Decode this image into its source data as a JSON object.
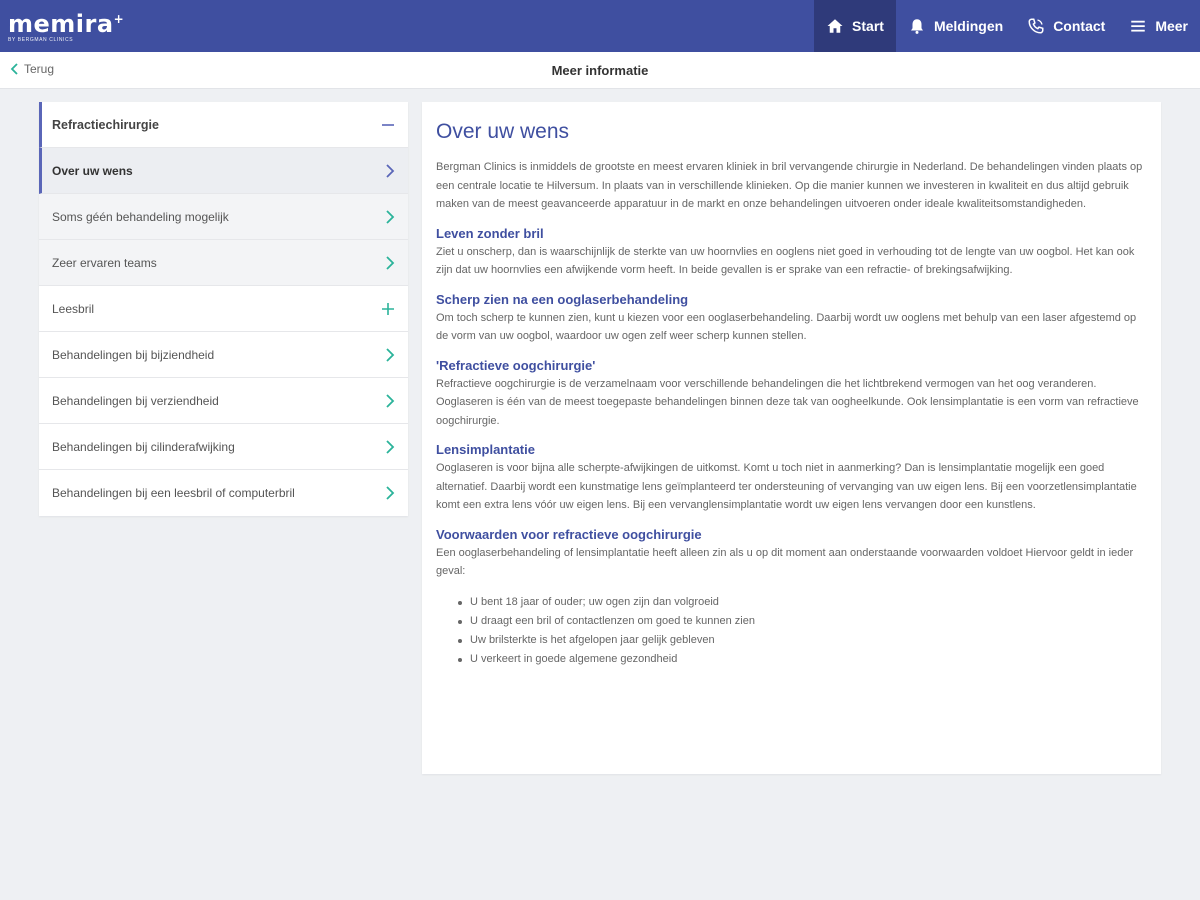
{
  "brand": {
    "name": "memira",
    "mark": "+",
    "tagline": "BY BERGMAN CLINICS"
  },
  "nav": {
    "items": [
      {
        "label": "Start",
        "icon": "home-icon",
        "active": true
      },
      {
        "label": "Meldingen",
        "icon": "bell-icon",
        "active": false
      },
      {
        "label": "Contact",
        "icon": "phone-icon",
        "active": false
      },
      {
        "label": "Meer",
        "icon": "menu-icon",
        "active": false
      }
    ]
  },
  "subheader": {
    "back_label": "Terug",
    "title": "Meer informatie"
  },
  "sidebar": {
    "items": [
      {
        "label": "Refractiechirurgie",
        "icon": "minus-icon"
      },
      {
        "label": "Over uw wens",
        "icon": "chevron-right-icon"
      },
      {
        "label": "Soms géén behandeling mogelijk",
        "icon": "chevron-right-icon"
      },
      {
        "label": "Zeer ervaren teams",
        "icon": "chevron-right-icon"
      },
      {
        "label": "Leesbril",
        "icon": "plus-icon"
      },
      {
        "label": "Behandelingen bij bijziendheid",
        "icon": "chevron-right-icon"
      },
      {
        "label": "Behandelingen bij verziendheid",
        "icon": "chevron-right-icon"
      },
      {
        "label": "Behandelingen bij cilinderafwijking",
        "icon": "chevron-right-icon"
      },
      {
        "label": "Behandelingen bij een leesbril of computerbril",
        "icon": "chevron-right-icon"
      }
    ]
  },
  "content": {
    "title": "Over uw wens",
    "intro": "Bergman Clinics is inmiddels de grootste en meest ervaren kliniek in bril vervangende chirurgie in Nederland. De behandelingen vinden plaats op een centrale locatie te Hilversum. In plaats van in verschillende klinieken. Op die manier kunnen we investeren in kwaliteit en dus altijd gebruik maken van de meest geavanceerde apparatuur in de markt en onze behandelingen uitvoeren onder ideale kwaliteitsomstandigheden.",
    "sections": [
      {
        "heading": "Leven zonder bril",
        "text": "Ziet u onscherp, dan is waarschijnlijk de sterkte van uw hoornvlies en ooglens niet goed in verhouding tot de lengte van uw oogbol. Het kan ook zijn dat uw hoornvlies een afwijkende vorm heeft. In beide gevallen is er sprake van een refractie- of brekingsafwijking."
      },
      {
        "heading": "Scherp zien na een ooglaserbehandeling",
        "text": "Om toch scherp te kunnen zien, kunt u kiezen voor een ooglaserbehandeling. Daarbij wordt uw ooglens met behulp van een laser afgestemd op de vorm van uw oogbol, waardoor uw ogen zelf weer scherp kunnen stellen."
      },
      {
        "heading": "'Refractieve oogchirurgie'",
        "text": "Refractieve oogchirurgie is de verzamelnaam voor verschillende behandelingen die het lichtbrekend vermogen van het oog veranderen. Ooglaseren is één van de meest toegepaste behandelingen binnen deze tak van oogheelkunde. Ook lensimplantatie is een vorm van refractieve oogchirurgie."
      },
      {
        "heading": "Lensimplantatie",
        "text": "Ooglaseren is voor bijna alle scherpte-afwijkingen de uitkomst. Komt u toch niet in aanmerking? Dan is lensimplantatie mogelijk een goed alternatief. Daarbij wordt een kunstmatige lens geïmplanteerd ter ondersteuning of vervanging van uw eigen lens. Bij een voorzetlensimplantatie komt een extra lens vóór uw eigen lens. Bij een vervanglensimplantatie wordt uw eigen lens vervangen door een kunstlens."
      },
      {
        "heading": "Voorwaarden voor refractieve oogchirurgie",
        "text": "Een ooglaserbehandeling of lensimplantatie heeft alleen zin als u op dit moment aan onderstaande voorwaarden voldoet Hiervoor  geldt in ieder geval:"
      }
    ],
    "bullets": [
      "U bent 18 jaar of ouder; uw ogen zijn dan volgroeid",
      "U draagt een bril of contactlenzen om goed te kunnen zien",
      "Uw brilsterkte is het afgelopen jaar gelijk gebleven",
      "U verkeert in goede algemene gezondheid"
    ]
  },
  "colors": {
    "primary": "#3f4fa0",
    "nav_active": "#2f3a7a",
    "accent_green": "#2bb39a",
    "accent_purple": "#5a66b8",
    "background": "#eef0f3"
  }
}
